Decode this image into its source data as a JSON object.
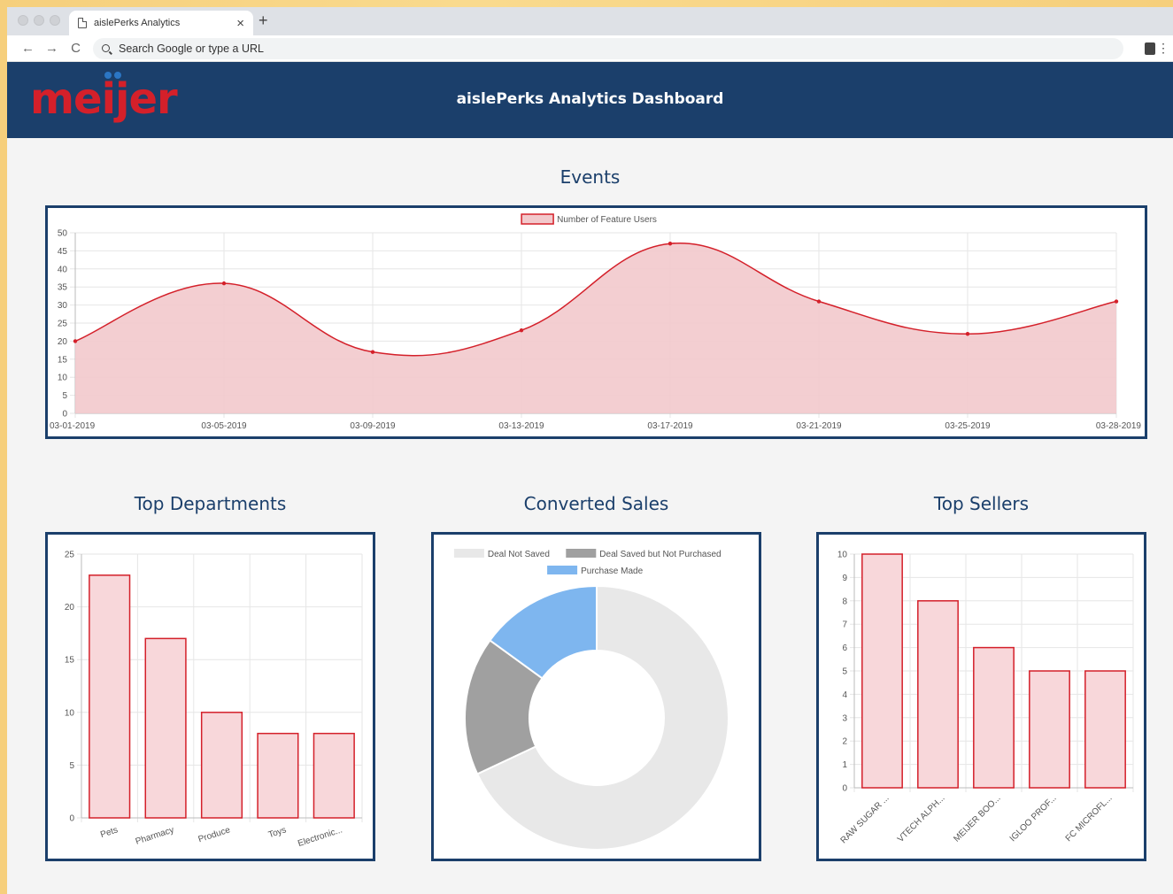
{
  "browser": {
    "tab_title": "aislePerks Analytics",
    "close_glyph": "×",
    "new_tab_glyph": "+",
    "back_glyph": "←",
    "forward_glyph": "→",
    "reload_glyph": "C",
    "address_placeholder": "Search Google or type a URL",
    "menu_glyph": "⋮"
  },
  "header": {
    "logo_text": "meijer",
    "title": "aislePerks Analytics Dashboard",
    "background_color": "#1b3f6b",
    "logo_color": "#d4202a"
  },
  "sections": {
    "events": "Events",
    "top_departments": "Top Departments",
    "converted_sales": "Converted Sales",
    "top_sellers": "Top Sellers"
  },
  "chart_data": [
    {
      "id": "events",
      "type": "area",
      "title": "Events",
      "series": [
        {
          "name": "Number of Feature Users",
          "values": [
            20,
            36,
            17,
            23,
            47,
            31,
            22,
            31
          ]
        }
      ],
      "categories": [
        "03-01-2019",
        "03-05-2019",
        "03-09-2019",
        "03-13-2019",
        "03-17-2019",
        "03-21-2019",
        "03-25-2019",
        "03-28-2019"
      ],
      "ylim": [
        0,
        50
      ],
      "yticks": [
        0,
        5,
        10,
        15,
        20,
        25,
        30,
        35,
        40,
        45,
        50
      ],
      "legend": "top",
      "grid": true,
      "line_color": "#d4202a",
      "fill_color": "#f2c9cc"
    },
    {
      "id": "top_departments",
      "type": "bar",
      "title": "Top Departments",
      "categories": [
        "Pets",
        "Pharmacy",
        "Produce",
        "Toys",
        "Electronic..."
      ],
      "values": [
        23,
        17,
        10,
        8,
        8
      ],
      "ylim": [
        0,
        25
      ],
      "yticks": [
        0,
        5,
        10,
        15,
        20,
        25
      ],
      "grid": true,
      "bar_color": "#f8d7da",
      "border_color": "#d4202a"
    },
    {
      "id": "converted_sales",
      "type": "pie",
      "title": "Converted Sales",
      "labels": [
        "Deal Not Saved",
        "Deal Saved but Not Purchased",
        "Purchase Made"
      ],
      "values": [
        68,
        17,
        15
      ],
      "colors": [
        "#e8e8e8",
        "#a0a0a0",
        "#7eb6ef"
      ],
      "legend": "top"
    },
    {
      "id": "top_sellers",
      "type": "bar",
      "title": "Top Sellers",
      "categories": [
        "RAW SUGAR ...",
        "VTECH ALPH...",
        "MEIJER BOO...",
        "IGLOO PROF...",
        "FC MICROFL..."
      ],
      "values": [
        10,
        8,
        6,
        5,
        5
      ],
      "ylim": [
        0,
        10
      ],
      "yticks": [
        0,
        1,
        2,
        3,
        4,
        5,
        6,
        7,
        8,
        9,
        10
      ],
      "grid": true,
      "bar_color": "#f8d7da",
      "border_color": "#d4202a"
    }
  ]
}
